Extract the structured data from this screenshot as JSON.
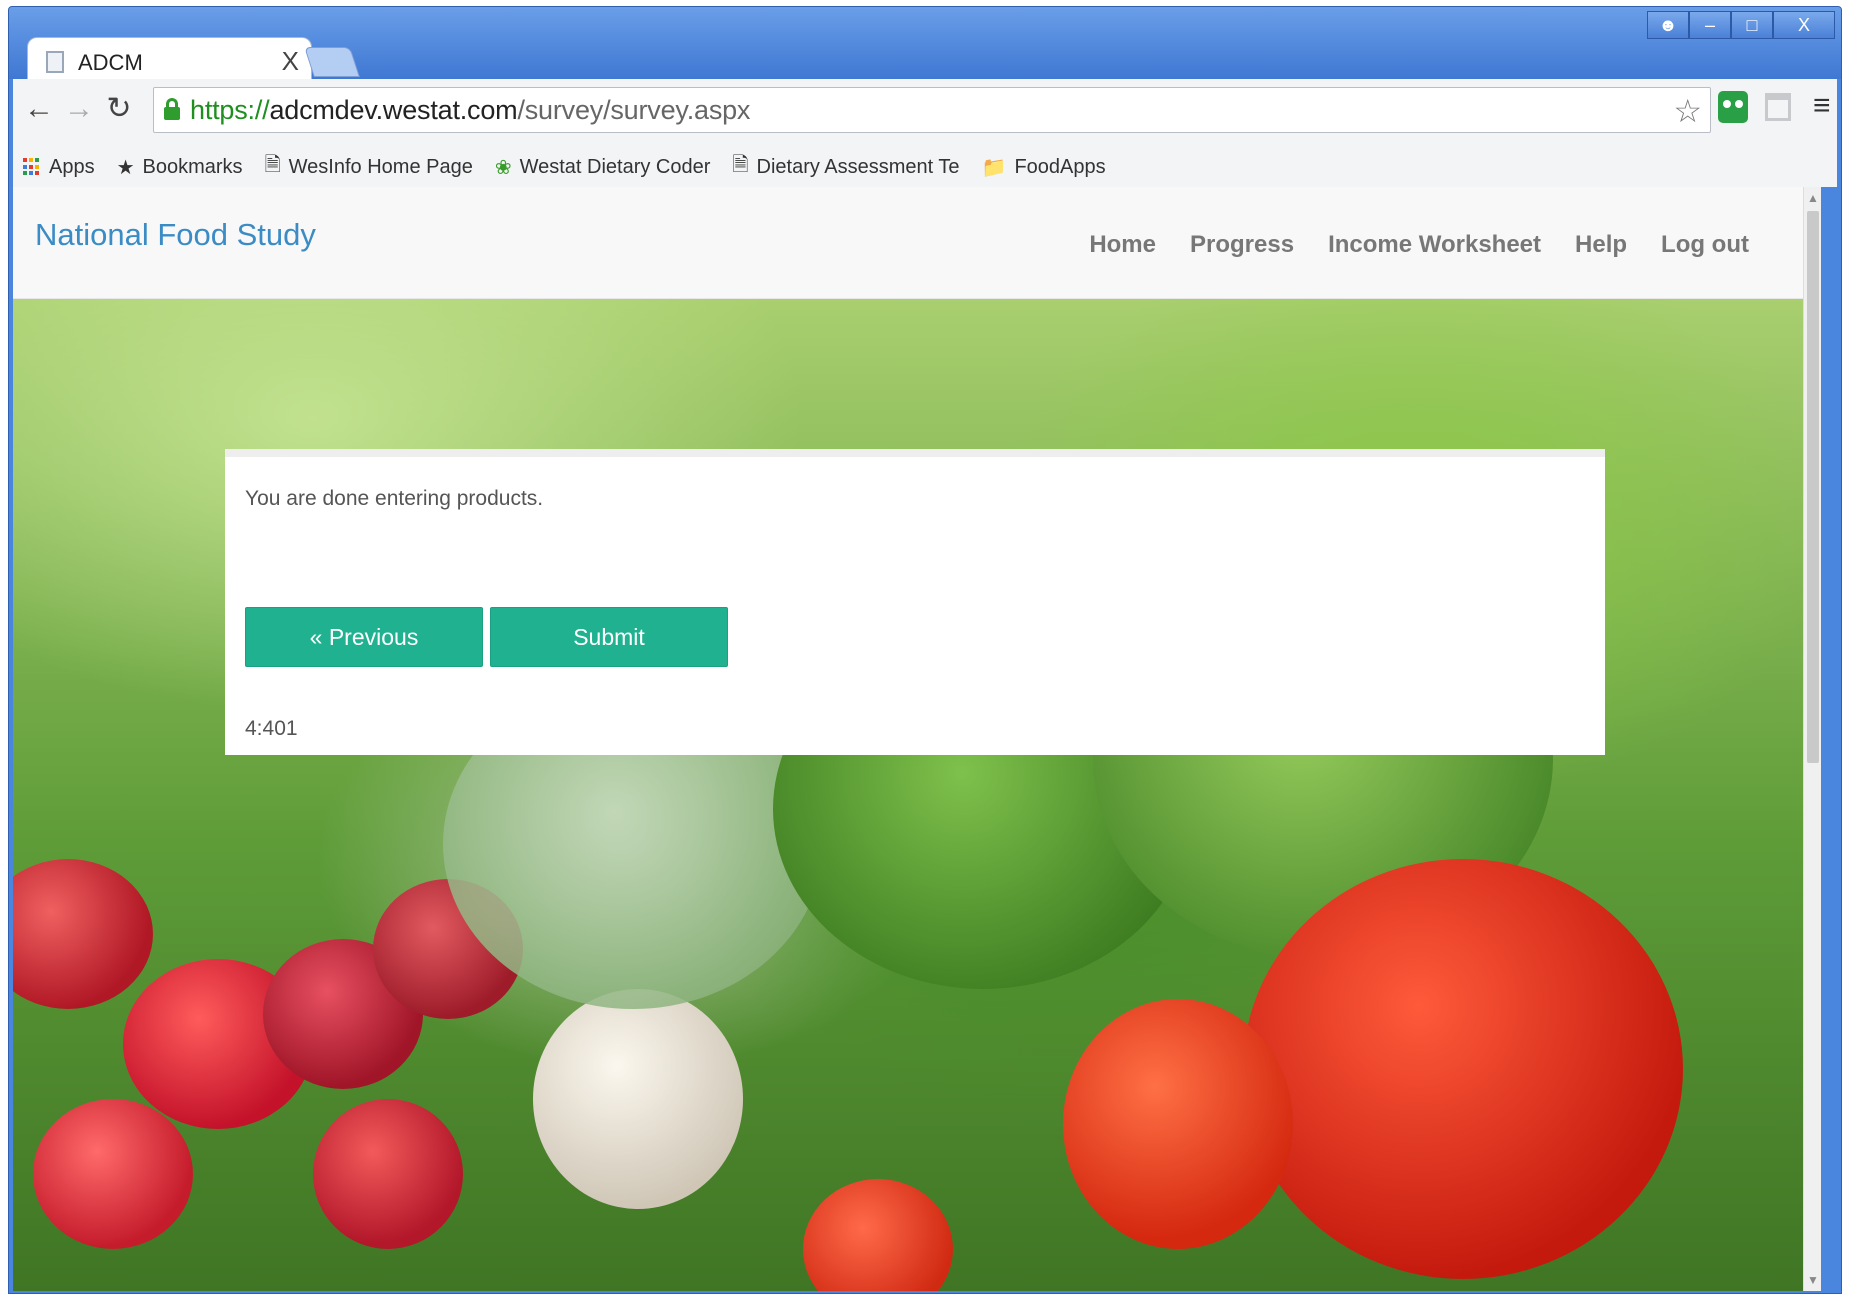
{
  "browser": {
    "tab_title": "ADCM",
    "tab_close": "X",
    "window_close": "X",
    "url_scheme": "https://",
    "url_host": "adcmdev.westat.com",
    "url_path": "/survey/survey.aspx",
    "bookmarks": [
      {
        "label": "Apps",
        "icon": "apps-grid-icon"
      },
      {
        "label": "Bookmarks",
        "icon": "star-icon"
      },
      {
        "label": "WesInfo Home Page",
        "icon": "page-icon"
      },
      {
        "label": "Westat Dietary Coder",
        "icon": "leaf-icon"
      },
      {
        "label": "Dietary Assessment Te",
        "icon": "page-icon"
      },
      {
        "label": "FoodApps",
        "icon": "folder-icon"
      }
    ]
  },
  "site": {
    "brand": "National Food Study",
    "nav": [
      "Home",
      "Progress",
      "Income Worksheet",
      "Help",
      "Log out"
    ]
  },
  "card": {
    "message": "You are done entering products.",
    "previous_label": "« Previous",
    "submit_label": "Submit",
    "code": "4:401"
  },
  "colors": {
    "accent": "#20b290",
    "brand": "#3b8cc5",
    "chrome": "#4a86de"
  }
}
